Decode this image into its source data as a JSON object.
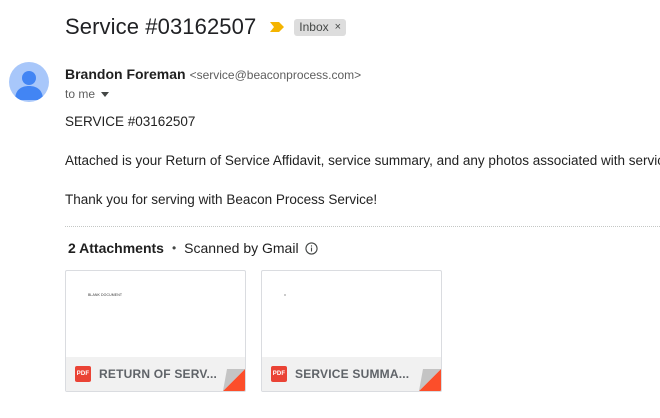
{
  "subject": "Service #03162507",
  "label": {
    "text": "Inbox",
    "remove_symbol": "×"
  },
  "sender": {
    "name": "Brandon Foreman",
    "email": "<service@beaconprocess.com>",
    "to_text": "to me"
  },
  "body": {
    "line1": "SERVICE #03162507",
    "line2": "Attached is your Return of Service Affidavit, service summary, and any photos associated with service.",
    "line3": "Thank you for serving with Beacon Process Service!"
  },
  "attachments": {
    "count_label": "2 Attachments",
    "separator": "•",
    "scanned_label": "Scanned by Gmail",
    "items": [
      {
        "name": "RETURN OF SERV...",
        "type": "PDF",
        "preview_text": "BLANK DOCUMENT"
      },
      {
        "name": "SERVICE SUMMA...",
        "type": "PDF",
        "preview_text": ""
      }
    ]
  },
  "icons": {
    "importance": "importance-marker-icon",
    "avatar": "default-avatar-icon",
    "caret": "caret-down-icon",
    "info": "info-icon",
    "pdf": "pdf-icon"
  },
  "colors": {
    "importance": "#f4b400",
    "avatar_bg": "#a8c7fa",
    "avatar_fg": "#4285f4",
    "pdf": "#ea4335",
    "fold_accent": "#fc4e2a"
  }
}
